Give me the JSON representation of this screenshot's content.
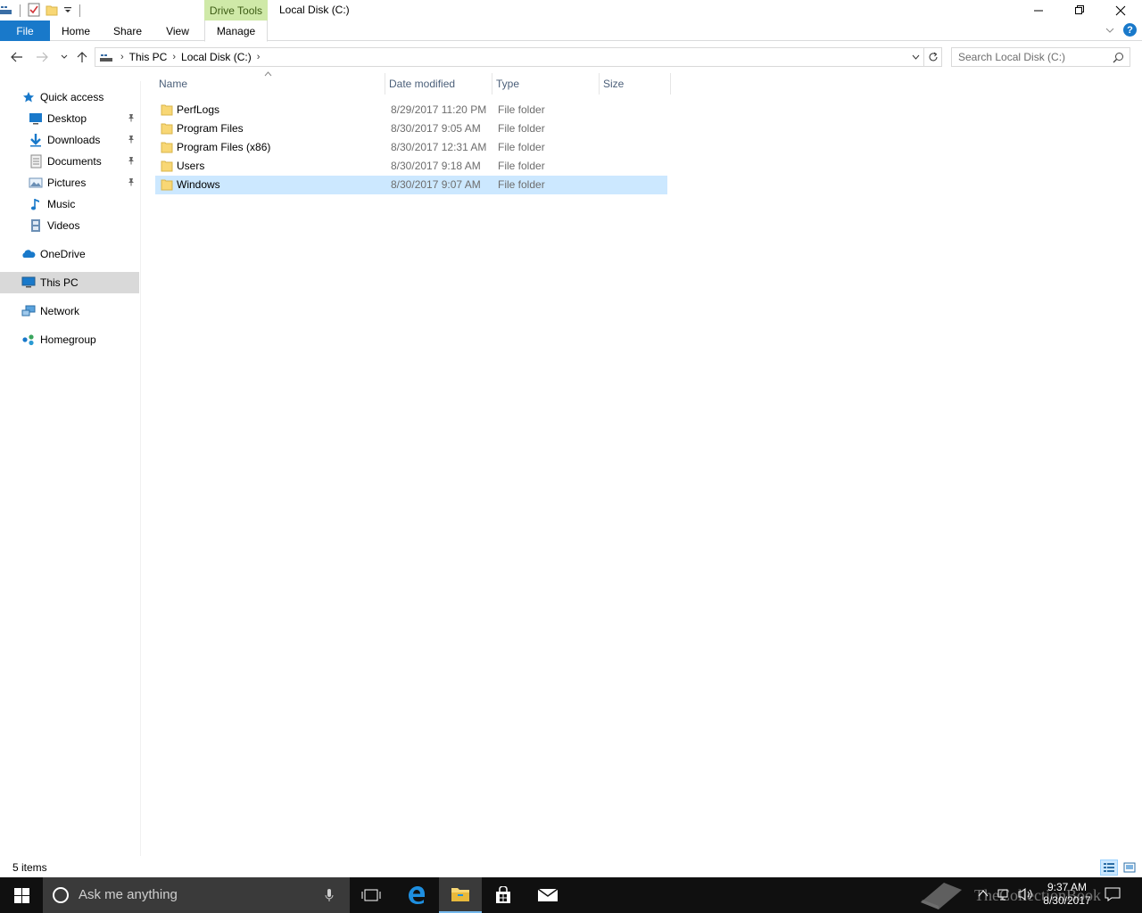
{
  "window": {
    "title": "Local Disk (C:)",
    "context_tab_group": "Drive Tools"
  },
  "ribbon": {
    "tabs": [
      {
        "label": "File"
      },
      {
        "label": "Home"
      },
      {
        "label": "Share"
      },
      {
        "label": "View"
      },
      {
        "label": "Manage"
      }
    ]
  },
  "address": {
    "crumbs": [
      "This PC",
      "Local Disk (C:)"
    ]
  },
  "search": {
    "placeholder": "Search Local Disk (C:)"
  },
  "nav": {
    "items": [
      {
        "label": "Quick access",
        "icon": "star-icon"
      },
      {
        "label": "Desktop",
        "icon": "desktop-icon",
        "pinned": true
      },
      {
        "label": "Downloads",
        "icon": "download-icon",
        "pinned": true
      },
      {
        "label": "Documents",
        "icon": "documents-icon",
        "pinned": true
      },
      {
        "label": "Pictures",
        "icon": "pictures-icon",
        "pinned": true
      },
      {
        "label": "Music",
        "icon": "music-icon"
      },
      {
        "label": "Videos",
        "icon": "videos-icon"
      },
      {
        "label": "OneDrive",
        "icon": "onedrive-icon"
      },
      {
        "label": "This PC",
        "icon": "computer-icon",
        "selected": true
      },
      {
        "label": "Network",
        "icon": "network-icon"
      },
      {
        "label": "Homegroup",
        "icon": "homegroup-icon"
      }
    ]
  },
  "columns": {
    "name": "Name",
    "date": "Date modified",
    "type": "Type",
    "size": "Size"
  },
  "files": [
    {
      "name": "PerfLogs",
      "date": "8/29/2017 11:20 PM",
      "type": "File folder",
      "size": ""
    },
    {
      "name": "Program Files",
      "date": "8/30/2017 9:05 AM",
      "type": "File folder",
      "size": ""
    },
    {
      "name": "Program Files (x86)",
      "date": "8/30/2017 12:31 AM",
      "type": "File folder",
      "size": ""
    },
    {
      "name": "Users",
      "date": "8/30/2017 9:18 AM",
      "type": "File folder",
      "size": ""
    },
    {
      "name": "Windows",
      "date": "8/30/2017 9:07 AM",
      "type": "File folder",
      "size": "",
      "selected": true
    }
  ],
  "status": {
    "item_count": "5 items"
  },
  "taskbar": {
    "search_placeholder": "Ask me anything",
    "time": "9:37 AM",
    "date": "8/30/2017",
    "watermark": "TheCollectionBook"
  },
  "colors": {
    "accent": "#1979ca",
    "selection": "#cce8ff",
    "context_tab": "#cfe9a8",
    "folder": "#f8d775"
  }
}
